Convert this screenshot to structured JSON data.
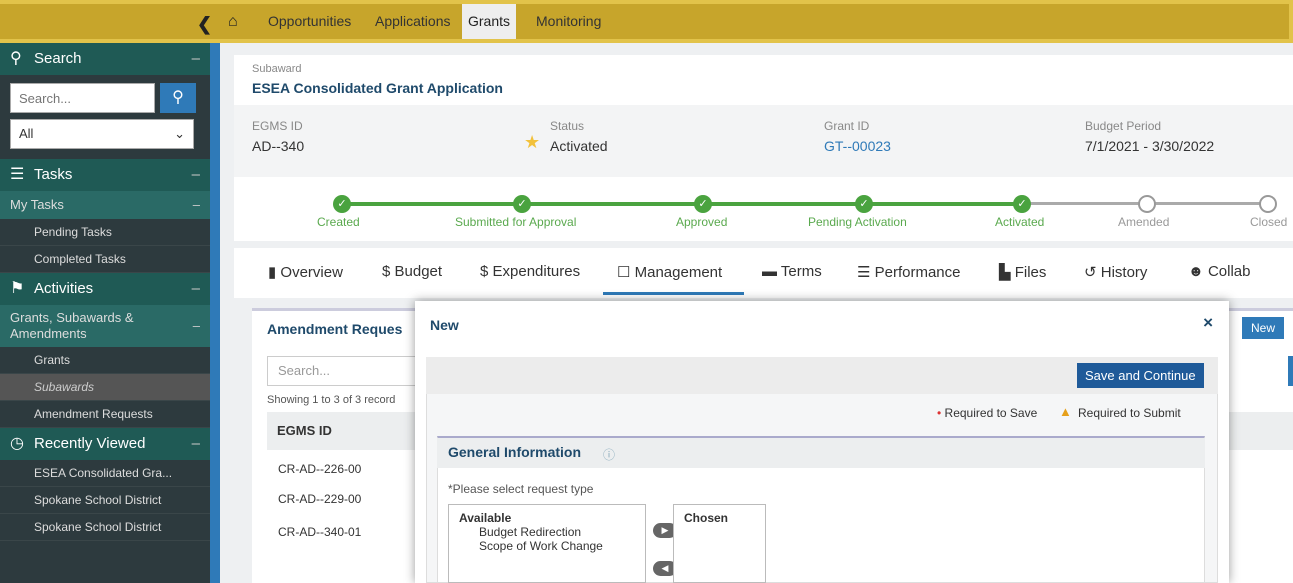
{
  "topnav": {
    "items": [
      "Opportunities",
      "Applications",
      "Grants",
      "Monitoring"
    ],
    "active": "Grants"
  },
  "sidebar": {
    "search": {
      "title": "Search",
      "placeholder": "Search...",
      "filter_value": "All"
    },
    "tasks": {
      "title": "Tasks",
      "my_tasks": "My Tasks",
      "items": [
        "Pending Tasks",
        "Completed Tasks"
      ]
    },
    "activities": {
      "title": "Activities",
      "group": "Grants, Subawards & Amendments",
      "items": [
        "Grants",
        "Subawards",
        "Amendment Requests"
      ],
      "selected": "Subawards"
    },
    "recent": {
      "title": "Recently Viewed",
      "items": [
        "ESEA Consolidated Gra...",
        "Spokane School District",
        "Spokane School District"
      ]
    }
  },
  "header": {
    "type": "Subaward",
    "title": "ESEA Consolidated Grant Application",
    "fields": [
      {
        "label": "EGMS ID",
        "value": "AD--340"
      },
      {
        "label": "Status",
        "value": "Activated"
      },
      {
        "label": "Grant ID",
        "value": "GT--00023"
      },
      {
        "label": "Budget Period",
        "value": "7/1/2021 - 3/30/2022"
      }
    ]
  },
  "progress": [
    "Created",
    "Submitted for Approval",
    "Approved",
    "Pending Activation",
    "Activated",
    "Amended",
    "Closed"
  ],
  "tabs": [
    "Overview",
    "Budget",
    "Expenditures",
    "Management",
    "Terms",
    "Performance",
    "Files",
    "History",
    "Collab"
  ],
  "active_tab": "Management",
  "amend": {
    "title": "Amendment Reques",
    "new": "New",
    "search_placeholder": "Search...",
    "showing": "Showing 1 to 3 of 3 record",
    "col": "EGMS ID",
    "rows": [
      "CR-AD--226-00",
      "CR-AD--229-00",
      "CR-AD--340-01"
    ]
  },
  "modal": {
    "title": "New",
    "close": "×",
    "save": "Save and Continue",
    "req_save": "Required to Save",
    "req_submit": "Required to Submit",
    "section": "General Information",
    "prompt": "*Please select request type",
    "available": "Available",
    "options": [
      "Budget Redirection",
      "Scope of Work Change"
    ],
    "chosen": "Chosen"
  },
  "colors": {
    "topbar": "#c7a52b",
    "sidebar": "#2d3a3e",
    "accent": "#2f7ab8",
    "success": "#4aa33f"
  }
}
